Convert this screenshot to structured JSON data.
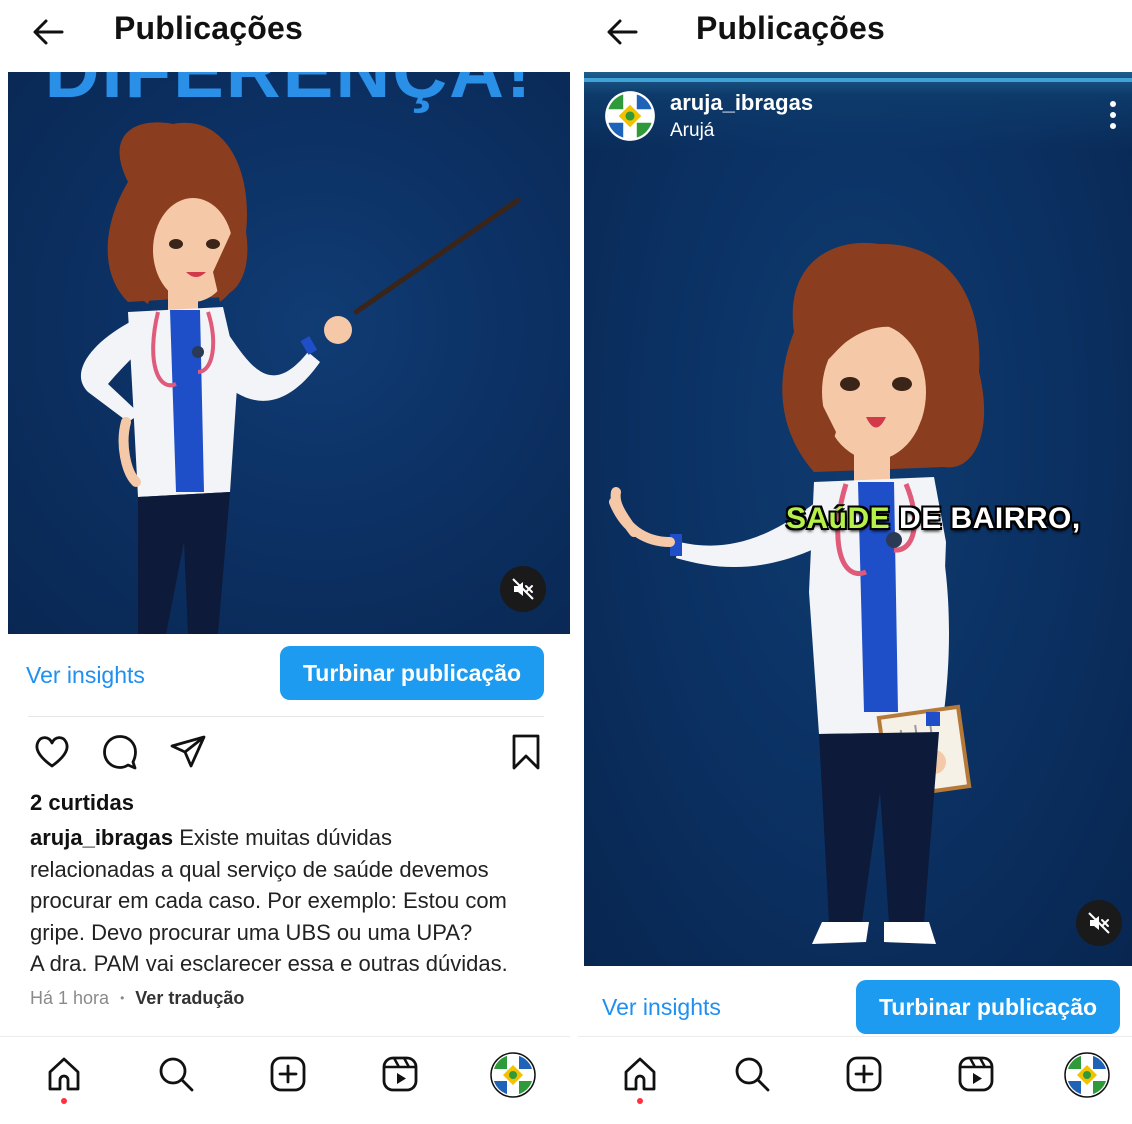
{
  "left_screen": {
    "header": {
      "title": "Publicações"
    },
    "media": {
      "banner_text": "DIFERENÇA!"
    },
    "insights_label": "Ver insights",
    "boost_label": "Turbinar publicação",
    "likes": "2 curtidas",
    "caption": {
      "username": "aruja_ibragas",
      "lines": [
        "Existe muitas dúvidas",
        "relacionadas a qual serviço de saúde devemos",
        "procurar em cada caso. Por exemplo: Estou com",
        "gripe. Devo procurar uma UBS ou uma UPA?",
        "A dra. PAM vai esclarecer essa e outras dúvidas."
      ]
    },
    "time": "Há 1 hora",
    "dot": "•",
    "translate_label": "Ver tradução"
  },
  "right_screen": {
    "header": {
      "title": "Publicações"
    },
    "reel": {
      "username": "aruja_ibragas",
      "location": "Arujá",
      "caption_highlight": "SAúDE",
      "caption_rest": " DE BAIRRO,"
    },
    "insights_label": "Ver insights",
    "boost_label": "Turbinar publicação"
  },
  "icons": {
    "back": "arrow-left-icon",
    "like": "heart-icon",
    "comment": "comment-icon",
    "share": "send-icon",
    "save": "bookmark-icon",
    "mute": "speaker-muted-icon",
    "more": "more-vertical-icon",
    "nav": [
      "home-icon",
      "search-icon",
      "create-icon",
      "reels-icon",
      "profile-avatar"
    ]
  },
  "colors": {
    "accent": "#1d9bf0",
    "link": "#1f8ff0",
    "media_bg": "#0b3163",
    "caption_highlight": "#b6f04a",
    "notification_dot": "#ff3040"
  }
}
